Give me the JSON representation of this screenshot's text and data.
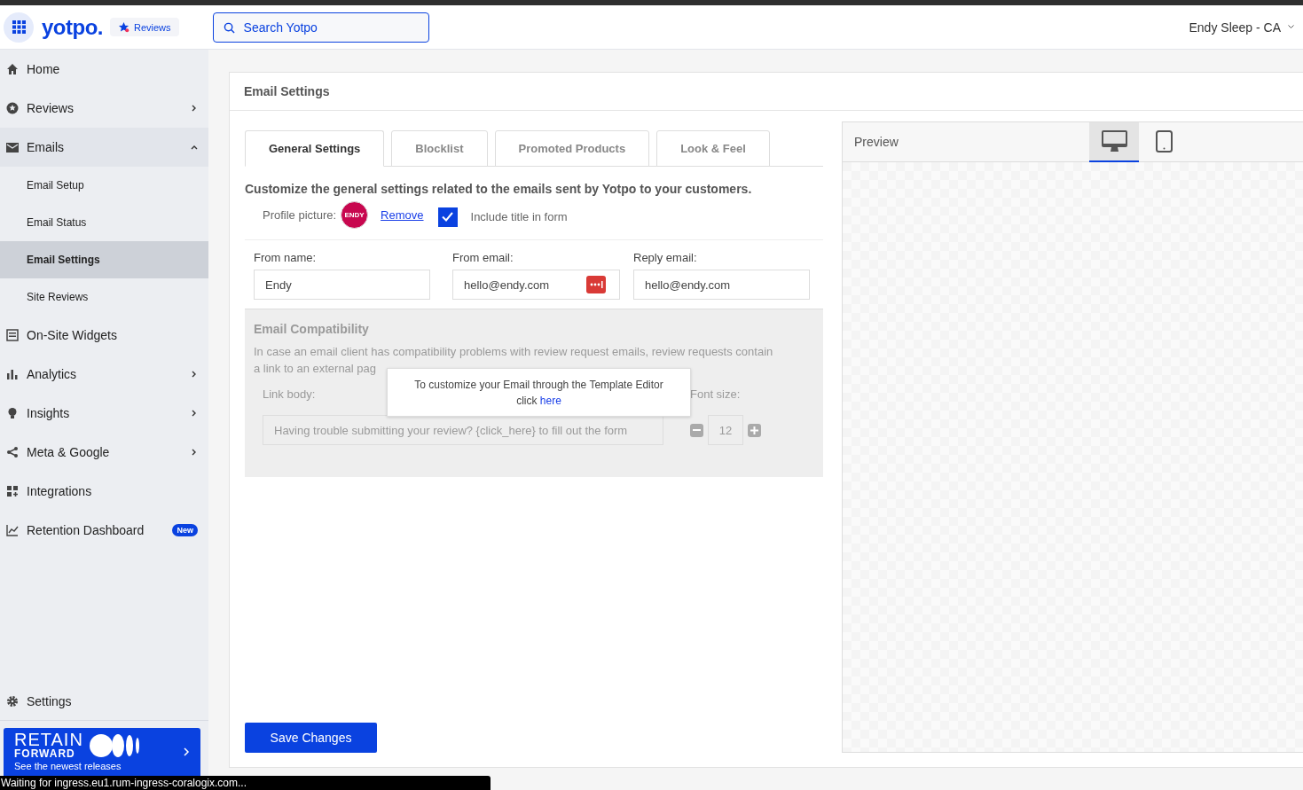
{
  "header": {
    "logo": "yotpo.",
    "product": "Reviews",
    "search": {
      "placeholder": "Search Yotpo"
    },
    "account": "Endy Sleep - CA"
  },
  "sidebar": {
    "items": [
      {
        "label": "Home",
        "selected": false
      },
      {
        "label": "Reviews",
        "selected": false,
        "expanded": false
      },
      {
        "label": "Emails",
        "selected": false,
        "expanded": true,
        "children": [
          {
            "label": "Email Setup",
            "selected": false
          },
          {
            "label": "Email Status",
            "selected": false
          },
          {
            "label": "Email Settings",
            "selected": true
          },
          {
            "label": "Site Reviews",
            "selected": false
          }
        ]
      },
      {
        "label": "On-Site Widgets",
        "selected": false
      },
      {
        "label": "Analytics",
        "selected": false,
        "expanded": false
      },
      {
        "label": "Insights",
        "selected": false,
        "expanded": false
      },
      {
        "label": "Meta & Google",
        "selected": false,
        "expanded": false
      },
      {
        "label": "Integrations",
        "selected": false
      },
      {
        "label": "Retention Dashboard",
        "selected": false,
        "badge": "New"
      }
    ],
    "settings": "Settings",
    "banner": {
      "title": "RETAIN",
      "subtitle": "FORWARD",
      "text": "See the newest releases"
    }
  },
  "page": {
    "title": "Email Settings",
    "tabs": [
      {
        "label": "General Settings",
        "selected": true
      },
      {
        "label": "Blocklist",
        "selected": false
      },
      {
        "label": "Promoted Products",
        "selected": false
      },
      {
        "label": "Look & Feel",
        "selected": false
      }
    ],
    "intro": "Customize the general settings related to the emails sent by Yotpo to your customers.",
    "profile": {
      "label": "Profile picture:",
      "avatar": "ENDY",
      "remove": "Remove"
    },
    "include_title": {
      "label": "Include title in form",
      "checked": true
    },
    "fields": [
      {
        "label": "From name:",
        "value": "Endy"
      },
      {
        "label": "From email:",
        "value": "hello@endy.com",
        "kind": "password"
      },
      {
        "label": "Reply email:",
        "value": "hello@endy.com"
      }
    ],
    "compatibility": {
      "title": "Email Compatibility",
      "text": "In case an email client has compatibility problems with review request emails, review requests contain a link to an external pag",
      "link_body_label": "Link body:",
      "link_body": "Having trouble submitting your review? {click_here} to fill out the form",
      "font_size_label": "Font size:",
      "font_size": "12"
    },
    "popup": {
      "text": "To customize your Email through the Template Editor",
      "prefix": "click",
      "link": "here"
    },
    "save": "Save Changes",
    "preview": {
      "title": "Preview",
      "devices": [
        {
          "kind": "desktop",
          "selected": true
        },
        {
          "kind": "tablet",
          "selected": false
        }
      ]
    }
  },
  "status_bar": "Waiting for ingress.eu1.rum-ingress-coralogix.com..."
}
